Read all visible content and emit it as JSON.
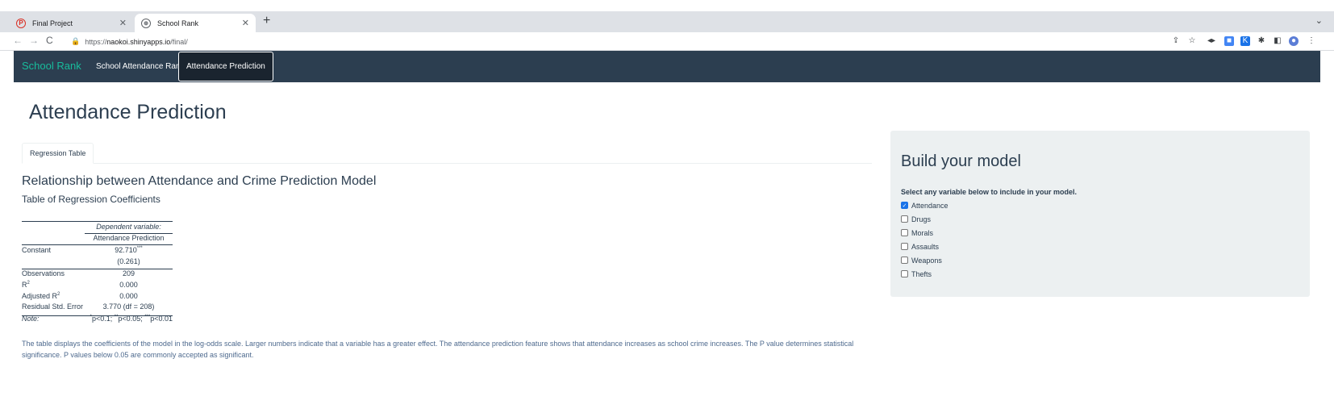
{
  "browser": {
    "tabs": [
      {
        "title": "Final Project",
        "favicon": "pinterest-icon"
      },
      {
        "title": "School Rank",
        "favicon": "globe-icon"
      }
    ],
    "url_prefix": "https://",
    "url_host": "naokoi.shinyapps.io",
    "url_path": "/final/"
  },
  "app_nav": {
    "brand": "School Rank",
    "items": [
      "School Attendance Rank",
      "Attendance Prediction"
    ],
    "active_item": "Attendance Prediction"
  },
  "page": {
    "title": "Attendance Prediction",
    "tab_label": "Regression Table",
    "heading": "Relationship between Attendance and Crime Prediction Model",
    "subheading": "Table of Regression Coefficients"
  },
  "regression_table": {
    "dep_var_header": "Dependent variable:",
    "dep_var_name": "Attendance Prediction",
    "constant_label": "Constant",
    "constant_value": "92.710",
    "constant_stars": "***",
    "constant_se": "(0.261)",
    "observations_label": "Observations",
    "observations_value": "209",
    "r2_label": "R",
    "r2_value": "0.000",
    "adj_r2_label": "Adjusted R",
    "adj_r2_value": "0.000",
    "rse_label": "Residual Std. Error",
    "rse_value": "3.770 (df = 208)",
    "note_label": "Note:",
    "note_star1": "*",
    "note_p1": "p<0.1; ",
    "note_star2": "**",
    "note_p2": "p<0.05; ",
    "note_star3": "***",
    "note_p3": "p<0.01"
  },
  "explanation": "The table displays the coefficients of the model in the log-odds scale. Larger numbers indicate that a variable has a greater effect. The attendance prediction feature shows that attendance increases as school crime increases. The P value determines statistical significance. P values below 0.05 are commonly accepted as significant.",
  "sidebar": {
    "title": "Build your model",
    "label": "Select any variable below to include in your model.",
    "options": [
      {
        "label": "Attendance",
        "checked": true
      },
      {
        "label": "Drugs",
        "checked": false
      },
      {
        "label": "Morals",
        "checked": false
      },
      {
        "label": "Assaults",
        "checked": false
      },
      {
        "label": "Weapons",
        "checked": false
      },
      {
        "label": "Thefts",
        "checked": false
      }
    ]
  },
  "colors": {
    "navbar": "#2c3e50",
    "brand": "#18bc9c",
    "sidebar_bg": "#ecf0f1",
    "note_text": "#4e6a8e"
  }
}
